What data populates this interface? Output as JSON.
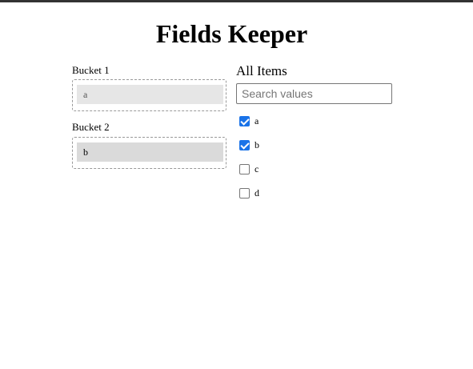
{
  "page": {
    "title": "Fields Keeper"
  },
  "buckets": [
    {
      "label": "Bucket 1",
      "chip": "a"
    },
    {
      "label": "Bucket 2",
      "chip": "b"
    }
  ],
  "all_items": {
    "title": "All Items",
    "search_placeholder": "Search values",
    "search_value": "",
    "items": [
      {
        "label": "a",
        "checked": true
      },
      {
        "label": "b",
        "checked": true
      },
      {
        "label": "c",
        "checked": false
      },
      {
        "label": "d",
        "checked": false
      }
    ]
  },
  "colors": {
    "checkbox_checked": "#1a73e8",
    "top_rule": "#333333"
  }
}
